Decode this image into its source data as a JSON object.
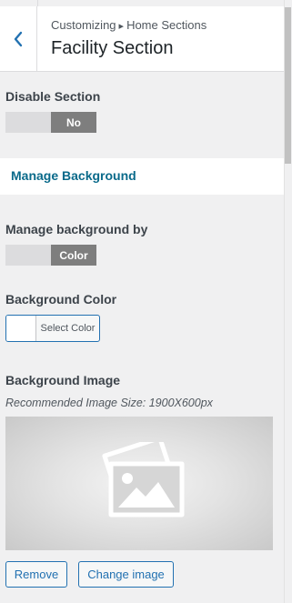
{
  "header": {
    "breadcrumb_parent": "Customizing",
    "breadcrumb_separator": "▸",
    "breadcrumb_current": "Home Sections",
    "title": "Facility Section",
    "back_icon": "chevron-left-icon"
  },
  "disable_section": {
    "label": "Disable Section",
    "value": "No"
  },
  "manage_background": {
    "label": "Manage Background"
  },
  "manage_background_by": {
    "label": "Manage background by",
    "value": "Color"
  },
  "background_color": {
    "label": "Background Color",
    "button_label": "Select Color",
    "current_color": "#ffffff"
  },
  "background_image": {
    "label": "Background Image",
    "hint": "Recommended Image Size: 1900X600px",
    "placeholder_icon": "image-icon",
    "remove_label": "Remove",
    "change_label": "Change image"
  },
  "colors": {
    "accent": "#2271b1",
    "link": "#0a6a8a",
    "switch_on": "#7e7e7e"
  }
}
